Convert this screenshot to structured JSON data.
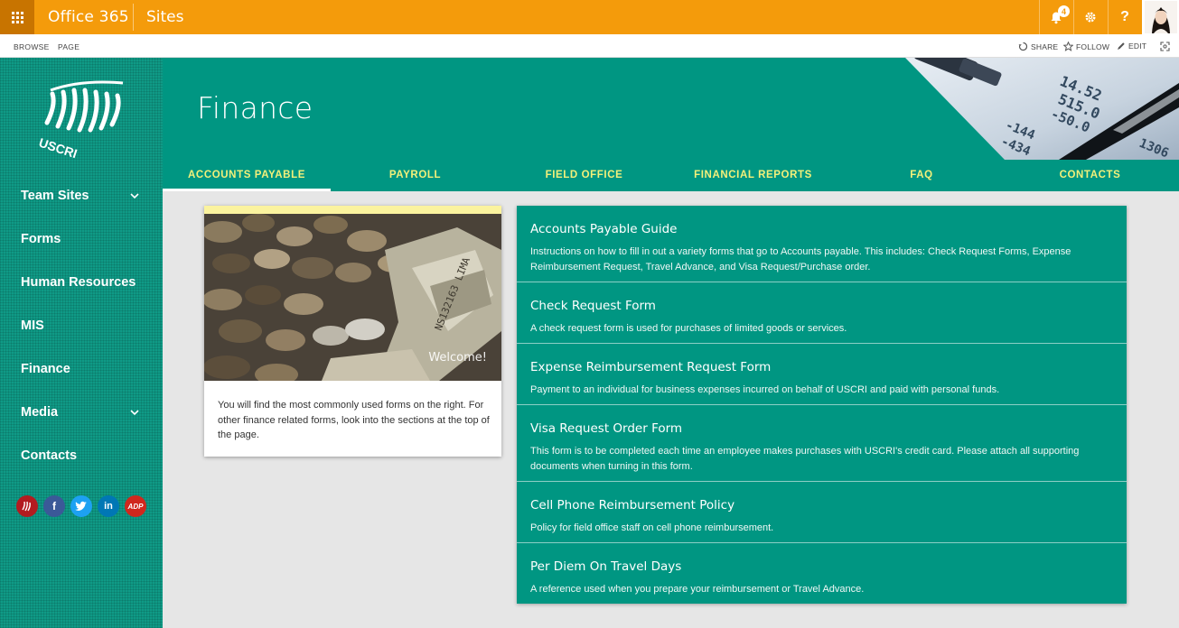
{
  "suitebar": {
    "brand": "Office 365",
    "app": "Sites",
    "notification_count": "4",
    "help_label": "?",
    "color": "#f49b0b"
  },
  "ribbon": {
    "tabs": [
      "BROWSE",
      "PAGE"
    ],
    "actions": {
      "share": "SHARE",
      "follow": "FOLLOW",
      "edit": "EDIT"
    }
  },
  "logo": {
    "text": "USCRI"
  },
  "leftnav": {
    "items": [
      {
        "label": "Team Sites",
        "has_children": true
      },
      {
        "label": "Forms"
      },
      {
        "label": "Human Resources"
      },
      {
        "label": "MIS"
      },
      {
        "label": "Finance"
      },
      {
        "label": "Media",
        "has_children": true
      },
      {
        "label": "Contacts"
      }
    ],
    "social": [
      {
        "name": "uscri-icon",
        "glyph": ""
      },
      {
        "name": "facebook-icon",
        "glyph": "f"
      },
      {
        "name": "twitter-icon",
        "glyph": ""
      },
      {
        "name": "linkedin-icon",
        "glyph": "in"
      },
      {
        "name": "adp-icon",
        "glyph": "ADP"
      }
    ]
  },
  "site": {
    "title": "Finance",
    "accent": "#009682"
  },
  "topnav": {
    "items": [
      "ACCOUNTS PAYABLE",
      "PAYROLL",
      "FIELD OFFICE",
      "FINANCIAL REPORTS",
      "FAQ",
      "CONTACTS"
    ],
    "active_index": 0
  },
  "welcome": {
    "image_label": "Welcome!",
    "text": "You will find the most commonly used forms on the right. For other finance related forms, look into the sections at the top of the page."
  },
  "forms": [
    {
      "title": "Accounts Payable Guide",
      "description": "Instructions on how to fill in out a variety forms that go to Accounts payable. This includes: Check Request Forms, Expense Reimbursement Request, Travel Advance, and Visa Request/Purchase order."
    },
    {
      "title": "Check Request Form",
      "description": "A check request form is used for purchases of limited goods or services."
    },
    {
      "title": "Expense Reimbursement Request Form",
      "description": "Payment to an individual for business expenses incurred on behalf of USCRI and paid with personal funds."
    },
    {
      "title": "Visa Request Order Form",
      "description": "This form is to be completed each time an employee makes purchases with USCRI's credit card. Please attach all supporting documents when turning in this form."
    },
    {
      "title": "Cell Phone Reimbursement Policy",
      "description": "Policy for field office staff on cell phone reimbursement."
    },
    {
      "title": "Per Diem On Travel Days",
      "description": "A reference used when you prepare your reimbursement or Travel Advance."
    }
  ]
}
